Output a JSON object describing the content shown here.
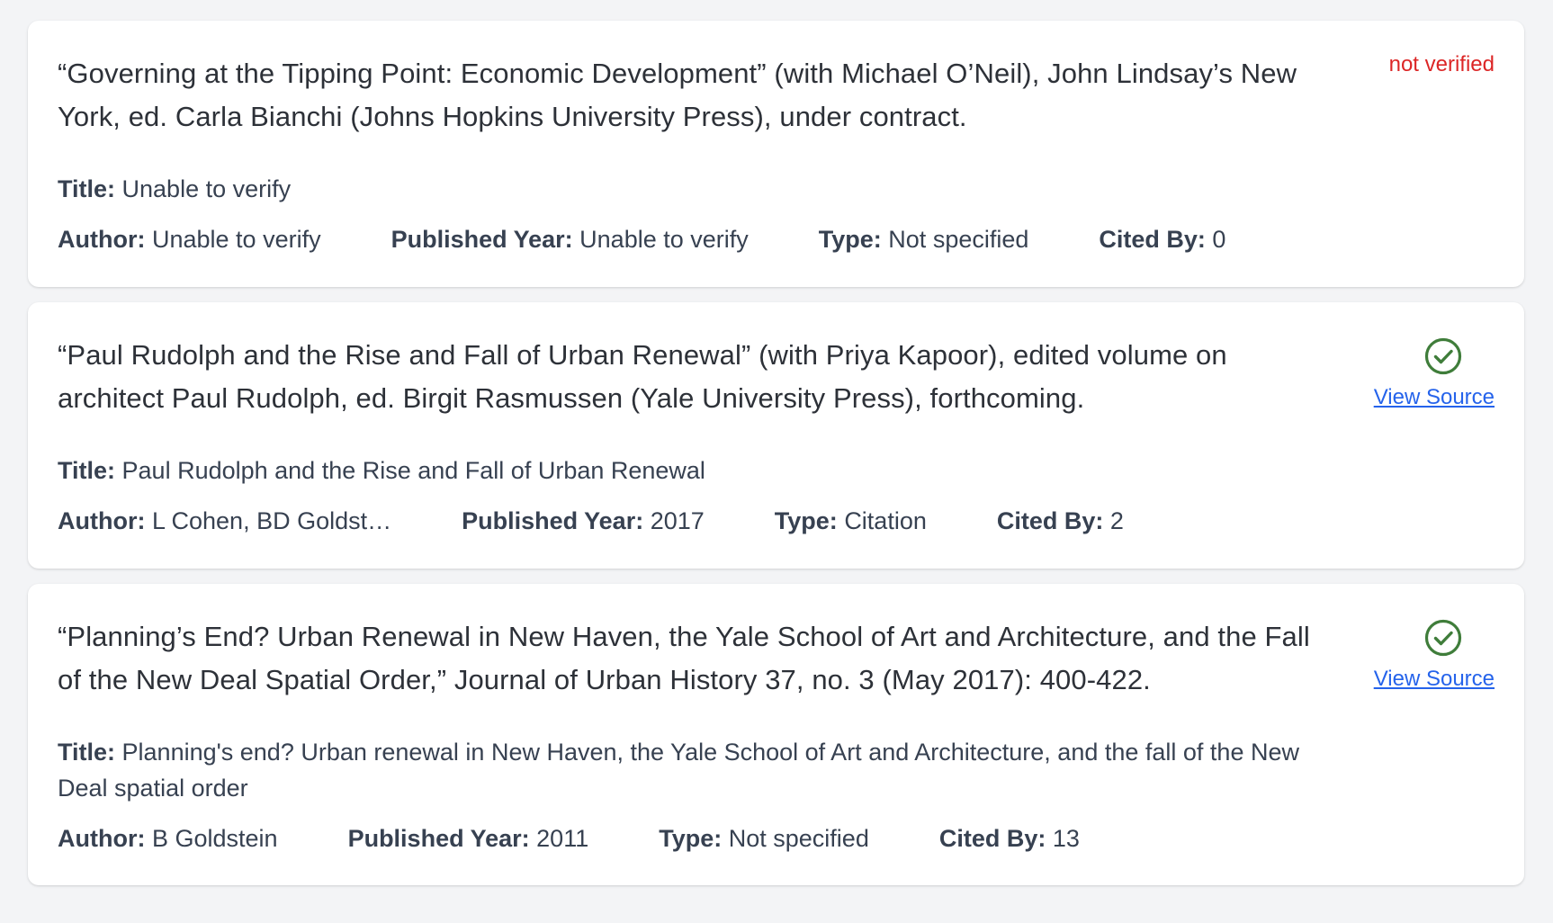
{
  "colors": {
    "background": "#f3f4f6",
    "card": "#ffffff",
    "not_verified": "#dc2626",
    "verified_check": "#3f7d3a",
    "link": "#2563eb"
  },
  "labels": {
    "title": "Title:",
    "author": "Author:",
    "published_year": "Published Year:",
    "type": "Type:",
    "cited_by": "Cited By:"
  },
  "entries": [
    {
      "citation": "“Governing at the Tipping Point: Economic Development” (with Michael O’Neil), John Lindsay’s New York, ed. Carla Bianchi (Johns Hopkins University Press), under contract.",
      "status": "not verified",
      "verified": false,
      "title": "Unable to verify",
      "author": "Unable to verify",
      "published_year": "Unable to verify",
      "type": "Not specified",
      "cited_by": "0"
    },
    {
      "citation": "“Paul Rudolph and the Rise and Fall of Urban Renewal” (with Priya Kapoor), edited volume on architect Paul Rudolph, ed. Birgit Rasmussen (Yale University Press), forthcoming.",
      "verified": true,
      "status_icon": "check-circle-icon",
      "view_source_label": "View Source",
      "title": "Paul Rudolph and the Rise and Fall of Urban Renewal",
      "author": "L Cohen, BD Goldst…",
      "published_year": "2017",
      "type": "Citation",
      "cited_by": "2"
    },
    {
      "citation": "“Planning’s End? Urban Renewal in New Haven, the Yale School of Art and Architecture, and the Fall of the New Deal Spatial Order,” Journal of Urban History 37, no. 3 (May 2017): 400-422.",
      "verified": true,
      "status_icon": "check-circle-icon",
      "view_source_label": "View Source",
      "title": "Planning's end? Urban renewal in New Haven, the Yale School of Art and Architecture, and the fall of the New Deal spatial order",
      "author": "B Goldstein",
      "published_year": "2011",
      "type": "Not specified",
      "cited_by": "13"
    }
  ]
}
